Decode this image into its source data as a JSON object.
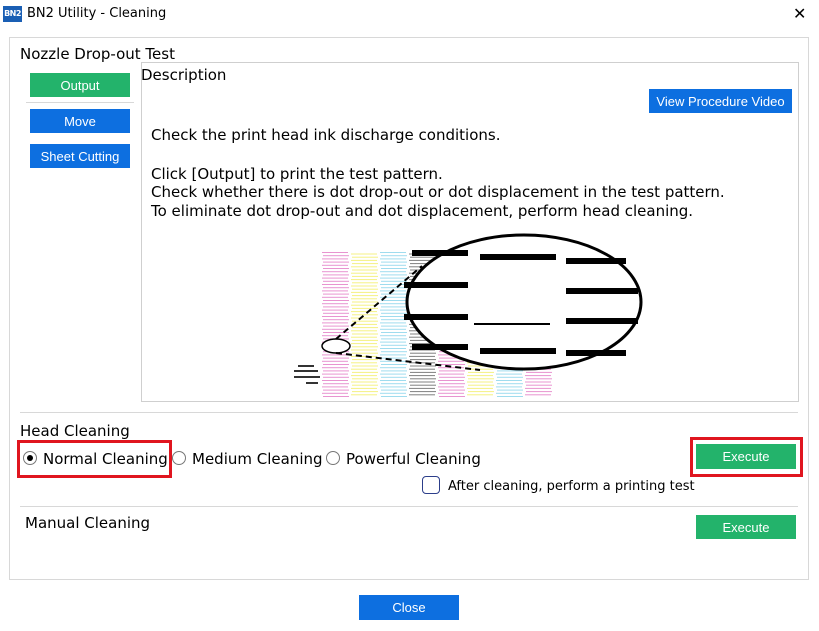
{
  "window": {
    "logo_text": "BN2",
    "title": "BN2 Utility - Cleaning",
    "close_glyph": "✕"
  },
  "nozzle_test": {
    "title": "Nozzle Drop-out Test",
    "buttons": {
      "output": "Output",
      "move": "Move",
      "sheet_cutting": "Sheet Cutting"
    },
    "description": {
      "heading": "Description",
      "video_button": "View Procedure Video",
      "line1": "Check the print head ink discharge conditions.",
      "line2": "Click [Output] to print the test pattern.",
      "line3": "Check whether there is dot drop-out or dot displacement in the test pattern.",
      "line4": "To eliminate dot drop-out and dot displacement, perform head cleaning."
    }
  },
  "head_cleaning": {
    "title": "Head Cleaning",
    "options": [
      {
        "label": "Normal Cleaning",
        "selected": true
      },
      {
        "label": "Medium Cleaning",
        "selected": false
      },
      {
        "label": "Powerful Cleaning",
        "selected": false
      }
    ],
    "execute": "Execute",
    "after_cleaning_label": "After cleaning, perform a printing test",
    "after_cleaning_checked": false
  },
  "manual_cleaning": {
    "title": "Manual Cleaning",
    "execute": "Execute"
  },
  "footer": {
    "close": "Close"
  },
  "colors": {
    "green": "#23b36b",
    "blue": "#0d6fe0",
    "highlight_red": "#e0151f",
    "pattern_magenta": "#e070c0",
    "pattern_yellow": "#f0ec5a",
    "pattern_cyan": "#7fd0e8",
    "pattern_black": "#555555"
  }
}
